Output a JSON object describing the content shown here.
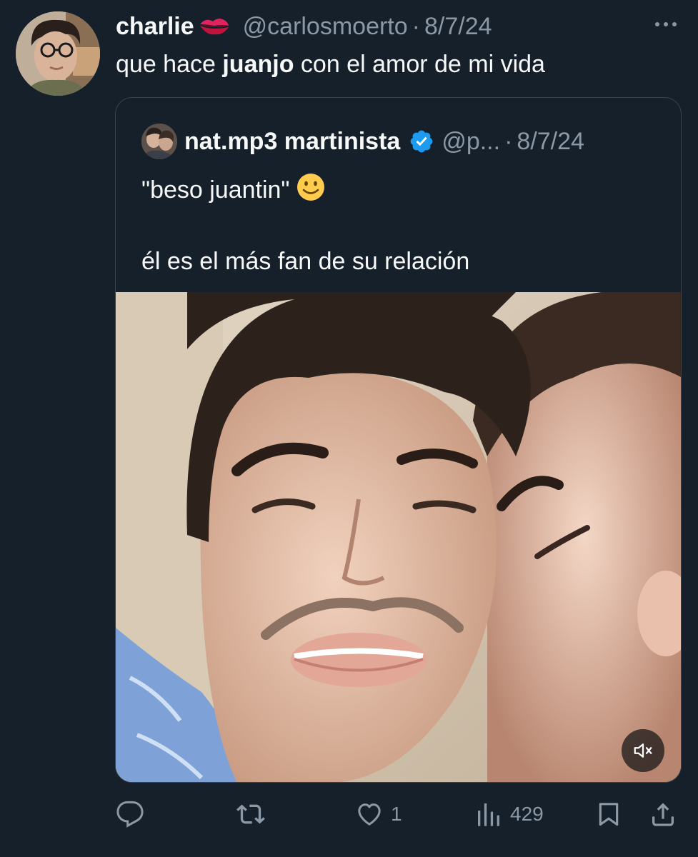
{
  "tweet": {
    "display_name": "charlie",
    "name_emoji": "kiss-mark",
    "handle": "@carlosmoerto",
    "separator": "·",
    "date": "8/7/24",
    "text_before": "que hace ",
    "text_bold": "juanjo",
    "text_after": " con el amor de mi vida"
  },
  "quote": {
    "display_name": "nat.mp3 martinista",
    "verified": true,
    "handle": "@p...",
    "separator": "·",
    "date": "8/7/24",
    "line1": "\"beso juantin\"",
    "line1_emoji": "slightly-smiling-face",
    "line2": "él es el más fan de su relación",
    "media": {
      "type": "video",
      "muted": true
    }
  },
  "actions": {
    "reply_count": "",
    "retweet_count": "",
    "like_count": "1",
    "views_count": "429"
  },
  "icons": [
    "more-icon",
    "verified-icon",
    "mute-icon",
    "reply-icon",
    "retweet-icon",
    "like-icon",
    "views-icon",
    "bookmark-icon",
    "share-icon"
  ],
  "colors": {
    "background": "#15202b",
    "text": "#f7f9f9",
    "secondary": "#8b98a5",
    "border": "#38444d",
    "verified": "#1d9bf0"
  }
}
